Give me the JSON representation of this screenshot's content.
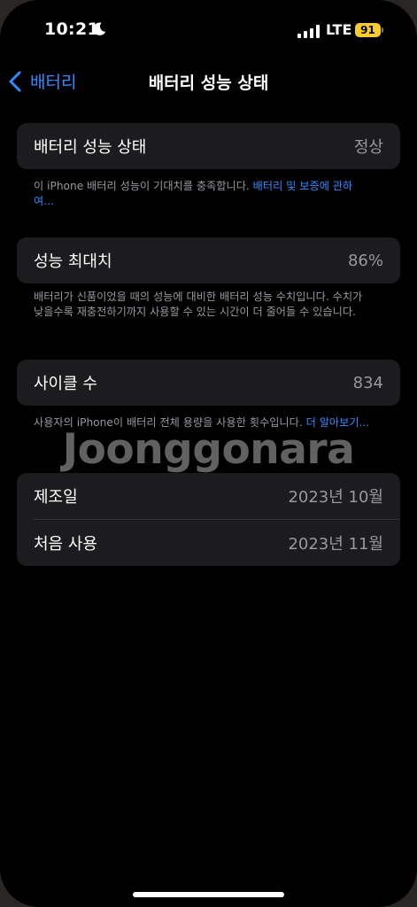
{
  "status_bar": {
    "time": "10:21",
    "network": "LTE",
    "battery": "91"
  },
  "nav": {
    "back_label": "배터리",
    "title": "배터리 성능 상태"
  },
  "health": {
    "label": "배터리 성능 상태",
    "value": "정상",
    "footnote": "이 iPhone 배터리 성능이 기대치를 충족합니다.",
    "footnote_link": "배터리 및 보증에 관하여..."
  },
  "max_capacity": {
    "label": "성능 최대치",
    "value": "86%",
    "footnote": "배터리가 신품이었을 때의 성능에 대비한 배터리 성능 수치입니다. 수치가 낮을수록 재충전하기까지 사용할 수 있는 시간이 더 줄어들 수 있습니다."
  },
  "cycle_count": {
    "label": "사이클 수",
    "value": "834",
    "footnote": "사용자의 iPhone이 배터리 전체 용량을 사용한 횟수입니다.",
    "footnote_link": "더 알아보기..."
  },
  "dates": {
    "manufacture_label": "제조일",
    "manufacture_value": "2023년 10월",
    "first_use_label": "처음 사용",
    "first_use_value": "2023년 11월"
  },
  "watermark": "Joonggonara",
  "icons": {
    "moon": "moon-icon",
    "signal": "signal-icon",
    "back": "chevron-left-icon"
  },
  "colors": {
    "accent": "#2f8bff",
    "battery": "#f6cd2c",
    "card": "#1c1c1e"
  }
}
